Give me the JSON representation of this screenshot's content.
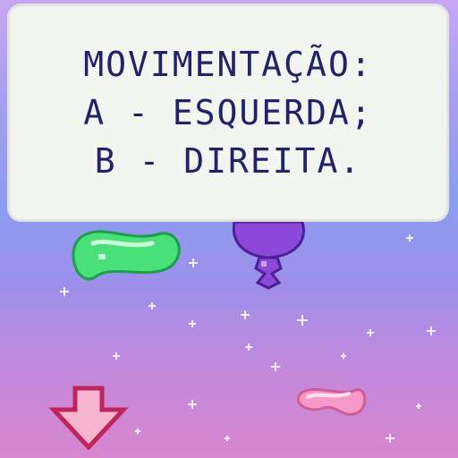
{
  "dialog": {
    "line1": "MOVIMENTAÇÃO:",
    "line2": "A - ESQUERDA;",
    "line3": "B - DIREITA."
  },
  "colors": {
    "text": "#20226a",
    "box": "#f3f5f0",
    "jelly_green": "#49e07a",
    "balloon_purple": "#8c48d8",
    "jelly_pink": "#f59ac8",
    "arrow_pink": "#f5b5cf",
    "arrow_outline": "#c0245e"
  },
  "sprites": [
    "jelly-bean-green",
    "balloon-purple",
    "jelly-bean-pink",
    "down-arrow-icon"
  ]
}
